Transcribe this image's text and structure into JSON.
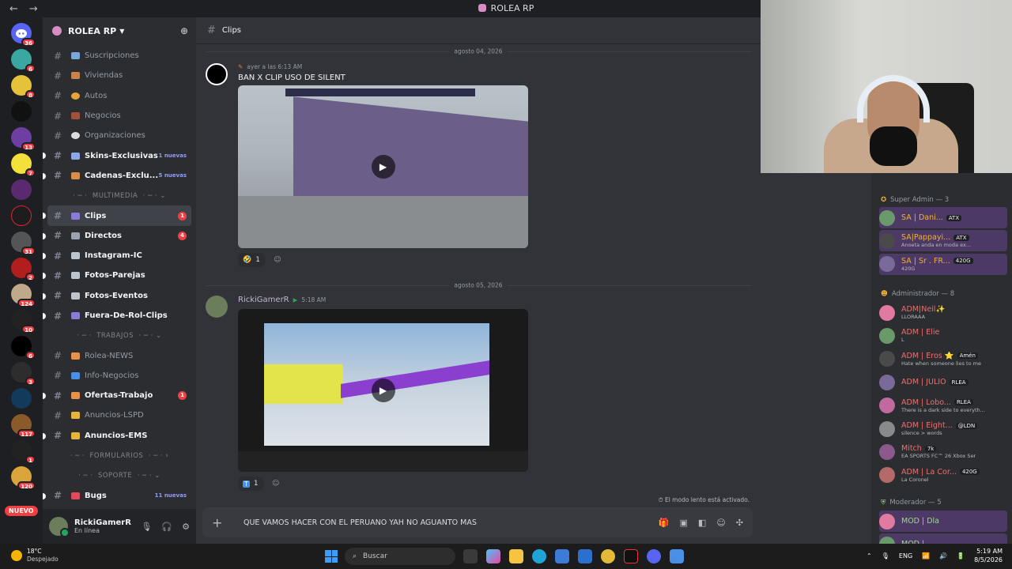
{
  "titlebar": {
    "back": "←",
    "forward": "→",
    "title": "ROLEA RP"
  },
  "guilds": {
    "badges": [
      "36",
      "6",
      "8",
      "",
      "13",
      "7",
      "",
      "",
      "31",
      "2",
      "124",
      "10",
      "6",
      "3",
      "",
      "117",
      "1",
      "120"
    ],
    "new_label": "NUEVO"
  },
  "server": {
    "name": "ROLEA RP",
    "channels": [
      {
        "name": "Suscripciones",
        "unread": false
      },
      {
        "name": "Viviendas",
        "unread": false
      },
      {
        "name": "Autos",
        "unread": false
      },
      {
        "name": "Negocios",
        "unread": false
      },
      {
        "name": "Organizaciones",
        "unread": false
      },
      {
        "name": "Skins-Exclusivas",
        "unread": true,
        "extra": "1 nuevas"
      },
      {
        "name": "Cadenas-Exclu...",
        "unread": true,
        "extra": "5 nuevas"
      }
    ],
    "cat_multimedia": "MULTIMEDIA",
    "multimedia": [
      {
        "name": "Clips",
        "unread": true,
        "count": "1"
      },
      {
        "name": "Directos",
        "unread": true,
        "count": "4"
      },
      {
        "name": "Instagram-IC",
        "unread": true
      },
      {
        "name": "Fotos-Parejas",
        "unread": true
      },
      {
        "name": "Fotos-Eventos",
        "unread": true
      },
      {
        "name": "Fuera-De-Rol-Clips",
        "unread": true
      }
    ],
    "cat_trabajos": "TRABAJOS",
    "trabajos": [
      {
        "name": "Rolea-NEWS",
        "unread": false
      },
      {
        "name": "Info-Negocios",
        "unread": false
      },
      {
        "name": "Ofertas-Trabajo",
        "unread": true,
        "count": "1"
      },
      {
        "name": "Anuncios-LSPD",
        "unread": false
      },
      {
        "name": "Anuncios-EMS",
        "unread": true
      }
    ],
    "cat_formularios": "FORMULARIOS",
    "cat_soporte": "SOPORTE",
    "soporte": [
      {
        "name": "Bugs",
        "unread": true,
        "extra": "11 nuevas"
      }
    ]
  },
  "user": {
    "name": "RickiGamerR",
    "status": "En línea"
  },
  "channel": {
    "name": "Clips"
  },
  "messages": [
    {
      "date": "agosto 04, 2026",
      "time": "ayer a las 6:13 AM",
      "text": "BAN X CLIP USO DE SILENT",
      "reaction_count": "1"
    },
    {
      "date": "agosto 05, 2026",
      "author": "RickiGamerR",
      "time": "5:18 AM",
      "reaction_count": "1"
    }
  ],
  "slowmode": "El modo lento está activado.",
  "composer": {
    "text": "QUE VAMOS HACER CON EL PERUANO YAH NO AGUANTO MAS"
  },
  "members": {
    "super_admin": "Super Admin — 3",
    "admins": "Administrador — 8",
    "mods": "Moderador — 5",
    "list_super": [
      {
        "name": "SA | Dani...",
        "tag": "ATX",
        "status": "",
        "color": "#f0b232"
      },
      {
        "name": "SA|Pappayi...",
        "tag": "ATX",
        "status": "Anoeta anda en moda ex...",
        "color": "#f0b232"
      },
      {
        "name": "SA | Sr . FR...",
        "tag": "420G",
        "status": "420G",
        "color": "#f0b232"
      }
    ],
    "list_admin": [
      {
        "name": "ADM|Neil✨",
        "tag": "",
        "status": "LLORAAA",
        "color": "#f26d6d"
      },
      {
        "name": "ADM | Elie",
        "tag": "",
        "status": "L",
        "color": "#f26d6d"
      },
      {
        "name": "ADM | Eros ⭐",
        "tag": "Amén",
        "status": "Hate when someone lies to me",
        "color": "#f26d6d"
      },
      {
        "name": "ADM | JULIO",
        "tag": "RLEA",
        "status": "",
        "color": "#f26d6d"
      },
      {
        "name": "ADM | Lobo...",
        "tag": "RLEA",
        "status": "There is a dark side to everyth...",
        "color": "#f26d6d"
      },
      {
        "name": "ADM | Eight...",
        "tag": "@LDN",
        "status": "silence > words",
        "color": "#f26d6d"
      },
      {
        "name": "Mitch",
        "tag": "7k",
        "status": "EA SPORTS FC™ 26 Xbox Ser",
        "color": "#f26d6d"
      },
      {
        "name": "ADM | La Cor...",
        "tag": "420G",
        "status": "La Coronel",
        "color": "#f26d6d"
      }
    ],
    "list_mod": [
      {
        "name": "MOD | Dla",
        "tag": "",
        "status": "",
        "color": "#9bd98e"
      },
      {
        "name": "MOD | ...",
        "tag": "",
        "status": "",
        "color": "#9bd98e"
      }
    ]
  },
  "taskbar": {
    "temp": "18°C",
    "weather": "Despejado",
    "search": "Buscar",
    "lang": "ENG",
    "time": "5:19 AM",
    "date": "8/5/2026"
  }
}
